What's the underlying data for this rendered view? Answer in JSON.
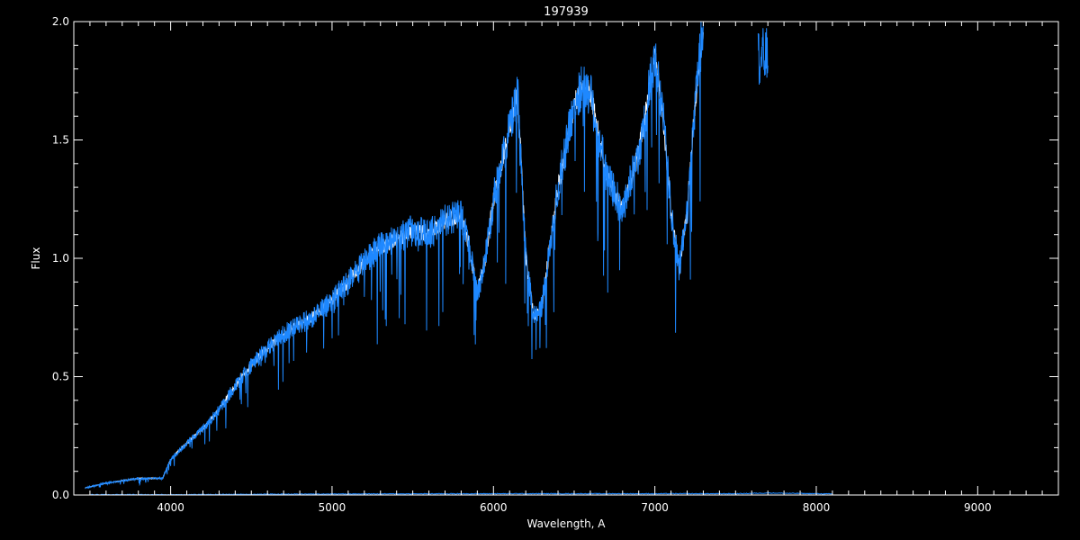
{
  "chart_data": {
    "type": "line",
    "title": "197939",
    "xlabel": "Wavelength, A",
    "ylabel": "Flux",
    "xlim": [
      3400,
      9500
    ],
    "ylim": [
      0,
      2.0
    ],
    "x_ticks": [
      4000,
      5000,
      6000,
      7000,
      8000,
      9000
    ],
    "y_ticks": [
      0.0,
      0.5,
      1.0,
      1.5,
      2.0
    ],
    "y_tick_labels": [
      "0.0",
      "0.5",
      "1.0",
      "1.5",
      "2.0"
    ],
    "grid": false,
    "colors": {
      "background": "#000000",
      "axes": "#ffffff",
      "spectrum": "#1e88ff",
      "model": "#ffffff"
    },
    "series": [
      {
        "role": "spectrum-envelope",
        "x": [
          3470,
          3600,
          3800,
          3950,
          4000,
          4100,
          4200,
          4300,
          4400,
          4500,
          4600,
          4700,
          4800,
          4900,
          5000,
          5100,
          5200,
          5300,
          5400,
          5500,
          5600,
          5700,
          5800,
          5850,
          5900,
          5950,
          6000,
          6050,
          6100,
          6150,
          6200,
          6250,
          6300,
          6400,
          6500,
          6550,
          6600,
          6700,
          6800,
          6900,
          7000,
          7050,
          7100,
          7150,
          7200,
          7250,
          7300
        ],
        "y": [
          0.03,
          0.05,
          0.07,
          0.07,
          0.15,
          0.22,
          0.28,
          0.36,
          0.46,
          0.55,
          0.62,
          0.68,
          0.72,
          0.76,
          0.82,
          0.9,
          0.98,
          1.05,
          1.08,
          1.12,
          1.1,
          1.16,
          1.18,
          1.05,
          0.85,
          1.0,
          1.25,
          1.4,
          1.55,
          1.7,
          1.0,
          0.75,
          0.8,
          1.3,
          1.65,
          1.72,
          1.7,
          1.35,
          1.2,
          1.45,
          1.85,
          1.6,
          1.2,
          0.95,
          1.2,
          1.65,
          2.0
        ]
      },
      {
        "role": "error-spectrum",
        "x": [
          3500,
          4000,
          5000,
          6000,
          7000,
          7500,
          7700,
          8000,
          8100
        ],
        "y": [
          0.0,
          0.0,
          0.003,
          0.004,
          0.004,
          0.004,
          0.007,
          0.004,
          0.003
        ]
      }
    ]
  }
}
